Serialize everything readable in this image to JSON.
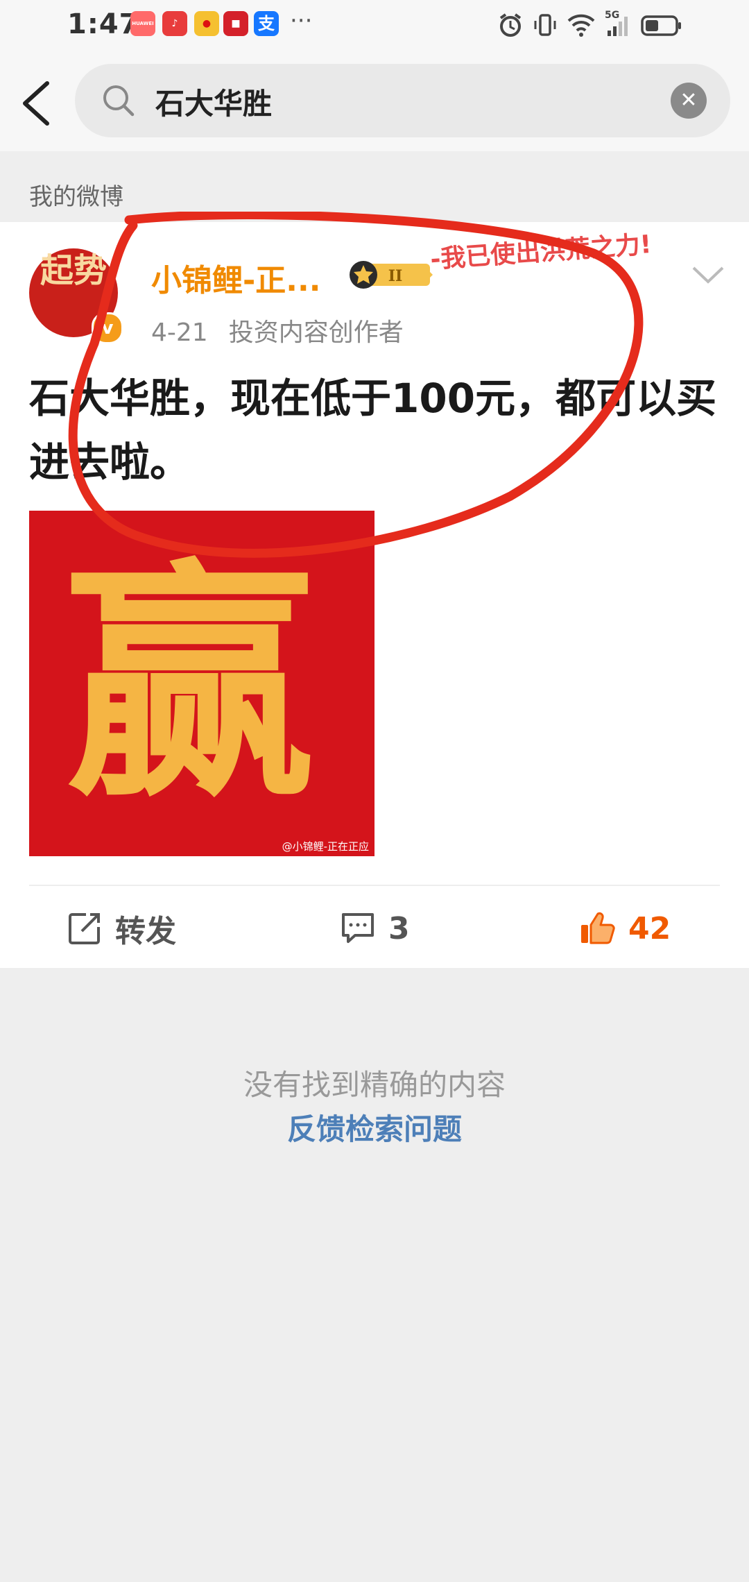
{
  "status_bar": {
    "time": "1:47",
    "app_icons": [
      {
        "name": "huawei-app",
        "text": "HUAWEI",
        "color": "#ff6a6a"
      },
      {
        "name": "music-app",
        "text": "♪",
        "color": "#e83c3c"
      },
      {
        "name": "weibo-app",
        "text": "●",
        "color": "#f5c030"
      },
      {
        "name": "red-app",
        "text": "■",
        "color": "#d4212a"
      },
      {
        "name": "alipay-app",
        "text": "支",
        "color": "#1677ff"
      }
    ],
    "more": "···",
    "network": "5G"
  },
  "search": {
    "query": "石大华胜"
  },
  "section": {
    "title": "我的微博"
  },
  "post": {
    "author": "小锦鲤-正...",
    "level_badge": "II",
    "avatar_text": "起势",
    "date": "4-21",
    "role": "投资内容创作者",
    "decor_text": "-我已使出洪荒之力!",
    "content": "石大华胜，现在低于100元，都可以买进去啦。",
    "image_char": "赢",
    "image_watermark": "@小锦鲤-正在正应",
    "repost_label": "转发",
    "comment_count": "3",
    "like_count": "42"
  },
  "empty_state": {
    "message": "没有找到精确的内容",
    "feedback_link": "反馈检索问题"
  },
  "colors": {
    "accent": "#f08a00",
    "link": "#4d7fb8",
    "annotation": "#e52b1c",
    "like": "#f05a00"
  }
}
